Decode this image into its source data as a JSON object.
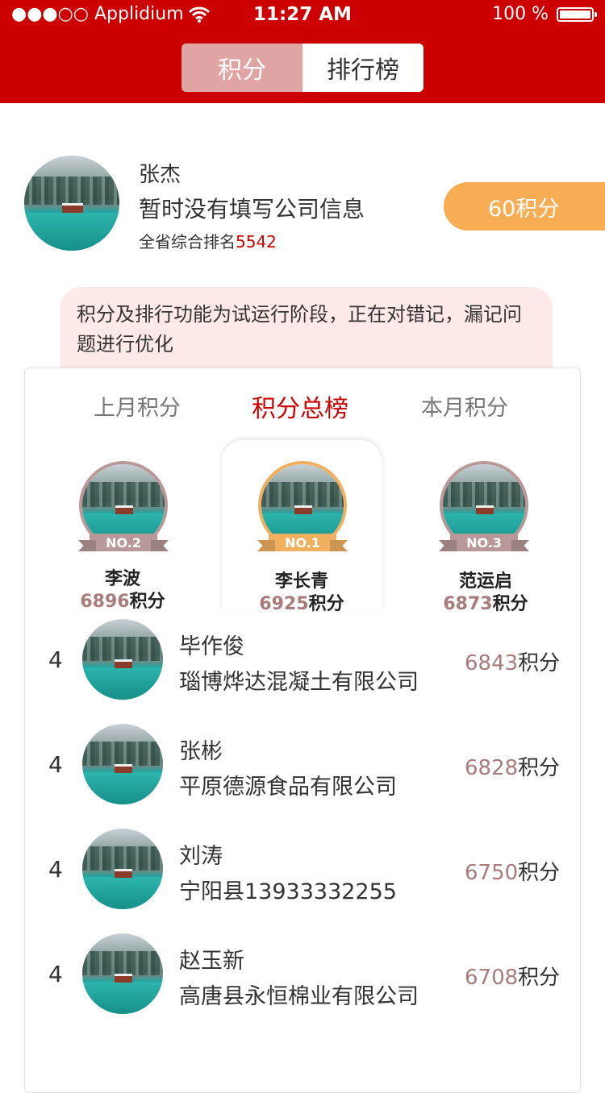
{
  "statusbar": {
    "carrier": "●●●○○ Applidium",
    "time": "11:27 AM",
    "battery": "100 %"
  },
  "segment": {
    "tab1": "积分",
    "tab2": "排行榜"
  },
  "profile": {
    "name": "张杰",
    "company": "暂时没有填写公司信息",
    "rank_label": "全省综合排名",
    "rank_value": "5542",
    "points": "60积分"
  },
  "notice": "积分及排行功能为试运行阶段，正在对错记，漏记问题进行优化",
  "tabs": {
    "last_month": "上月积分",
    "total": "积分总榜",
    "this_month": "本月积分"
  },
  "podium": {
    "first": {
      "badge": "NO.1",
      "name": "李长青",
      "score": "6925",
      "unit": "积分"
    },
    "second": {
      "badge": "NO.2",
      "name": "李波",
      "score": "6896",
      "unit": "积分"
    },
    "third": {
      "badge": "NO.3",
      "name": "范运启",
      "score": "6873",
      "unit": "积分"
    }
  },
  "list": [
    {
      "rank": "4",
      "name": "毕作俊",
      "company": "瑙博烨达混凝土有限公司",
      "score": "6843",
      "unit": "积分"
    },
    {
      "rank": "4",
      "name": "张彬",
      "company": "平原德源食品有限公司",
      "score": "6828",
      "unit": "积分"
    },
    {
      "rank": "4",
      "name": "刘涛",
      "company": "宁阳县13933332255",
      "score": "6750",
      "unit": "积分"
    },
    {
      "rank": "4",
      "name": "赵玉新",
      "company": "高唐县永恒棉业有限公司",
      "score": "6708",
      "unit": "积分"
    }
  ],
  "colors": {
    "header": "#cc0000",
    "gold": "#f0b060",
    "silver": "#b89898",
    "points_pill": "#f8ad55"
  }
}
